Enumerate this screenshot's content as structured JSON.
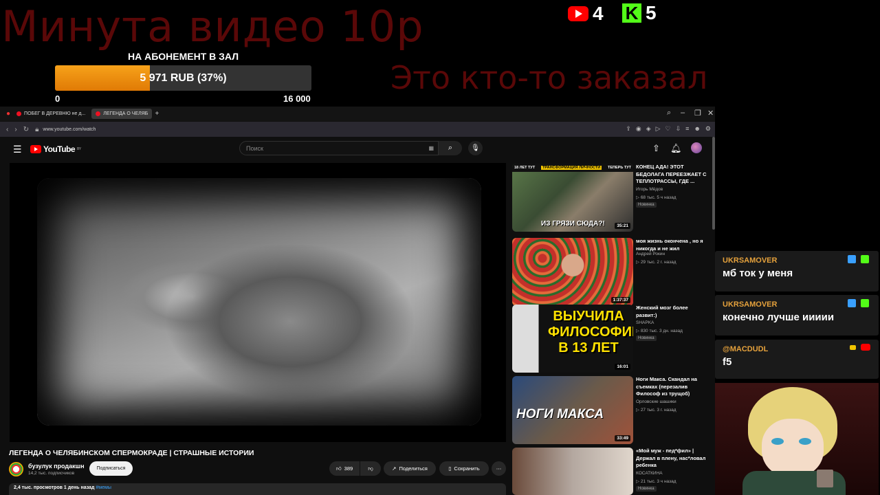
{
  "overlay": {
    "price_title": "Минута видео 10р",
    "goal_label": "НА АБОНЕМЕНТ В ЗАЛ",
    "goal_text": "5 971 RUB (37%)",
    "goal_fraction": 0.37,
    "goal_min": "0",
    "goal_max": "16 000",
    "ordered_text": "Это кто-то заказал",
    "youtube_count": "4",
    "kick_count": "5",
    "kick_letter": "K"
  },
  "browser": {
    "tabs": [
      {
        "label": "ПОБЕГ В ДЕРЕВНЮ не д..."
      },
      {
        "label": "ЛЕГЕНДА О ЧЕЛЯБ"
      }
    ],
    "new_tab": "+",
    "url": "www.youtube.com/watch"
  },
  "youtube": {
    "brand": "YouTube",
    "region": "BY",
    "search_placeholder": "Поиск",
    "video_title": "ЛЕГЕНДА О ЧЕЛЯБИНСКОМ СПЕРМОКРАДЕ | СТРАШНЫЕ ИСТОРИИ",
    "channel_name": "бузулук продакшн",
    "channel_subs": "14,2 тыс. подписчиков",
    "subscribe_label": "Подписаться",
    "likes": "389",
    "share_label": "Поделиться",
    "save_label": "Сохранить",
    "views": "2,4 тыс. просмотров  1 день назад",
    "hashtag": "#мемы"
  },
  "recommendations": [
    {
      "title": "КОНЕЦ АДА! ЭТОТ БЕДОЛАГА ПЕРЕЕЗЖАЕТ С ТЕПЛОТРАССЫ, ГДЕ ...",
      "channel": "Игорь Мёдов",
      "meta": "68 тыс.  5 ч назад",
      "badge": "Новинка",
      "duration": "35:21",
      "caption": "ИЗ ГРЯЗИ СЮДА?!",
      "top_left": "18 ЛЕТ ТУТ",
      "top_mid": "ТРАНСФОРМАЦИЯ ЛИЧНОСТИ",
      "top_right": "ТЕПЕРЬ ТУТ"
    },
    {
      "title": "моя жизнь окончена , но я никогда и не жил",
      "channel": "Андрей Рокин",
      "meta": "29 тыс.  2 г. назад",
      "badge": "",
      "duration": "1:37:37",
      "caption": ""
    },
    {
      "title": "Женский мозг более развит:)",
      "channel": "SHAPKA",
      "meta": "830 тыс.  3 дн. назад",
      "badge": "Новинка",
      "duration": "16:01",
      "caption": "ВЫУЧИЛА ФИЛОСОФИЮ В 13 ЛЕТ"
    },
    {
      "title": "Ноги Макса. Скандал на съемках (перезалив Философ из трущоб)",
      "channel": "Орловские шашики",
      "meta": "27 тыс.  3 г. назад",
      "badge": "",
      "duration": "33:49",
      "caption": "НОГИ МАКСА"
    },
    {
      "title": "«Мой муж - пед*фил» | Держал в плену, нас*ловал ребенка",
      "channel": "КОСАТКИНА",
      "meta": "21 тыс.  3 ч назад",
      "badge": "Новинка",
      "duration": "",
      "caption": ""
    }
  ],
  "chat": [
    {
      "user": "UKRSAMOVER",
      "text": "мб ток у меня"
    },
    {
      "user": "UKRSAMOVER",
      "text": "конечно лучше иииии"
    },
    {
      "user": "@MACDUDL",
      "text": "f5"
    }
  ],
  "colors": {
    "goal_fill": "#f39412",
    "title_red": "#5a0808",
    "chat_user": "#e6a23c",
    "kick_green": "#53fc18",
    "youtube_red": "#ff0000"
  }
}
